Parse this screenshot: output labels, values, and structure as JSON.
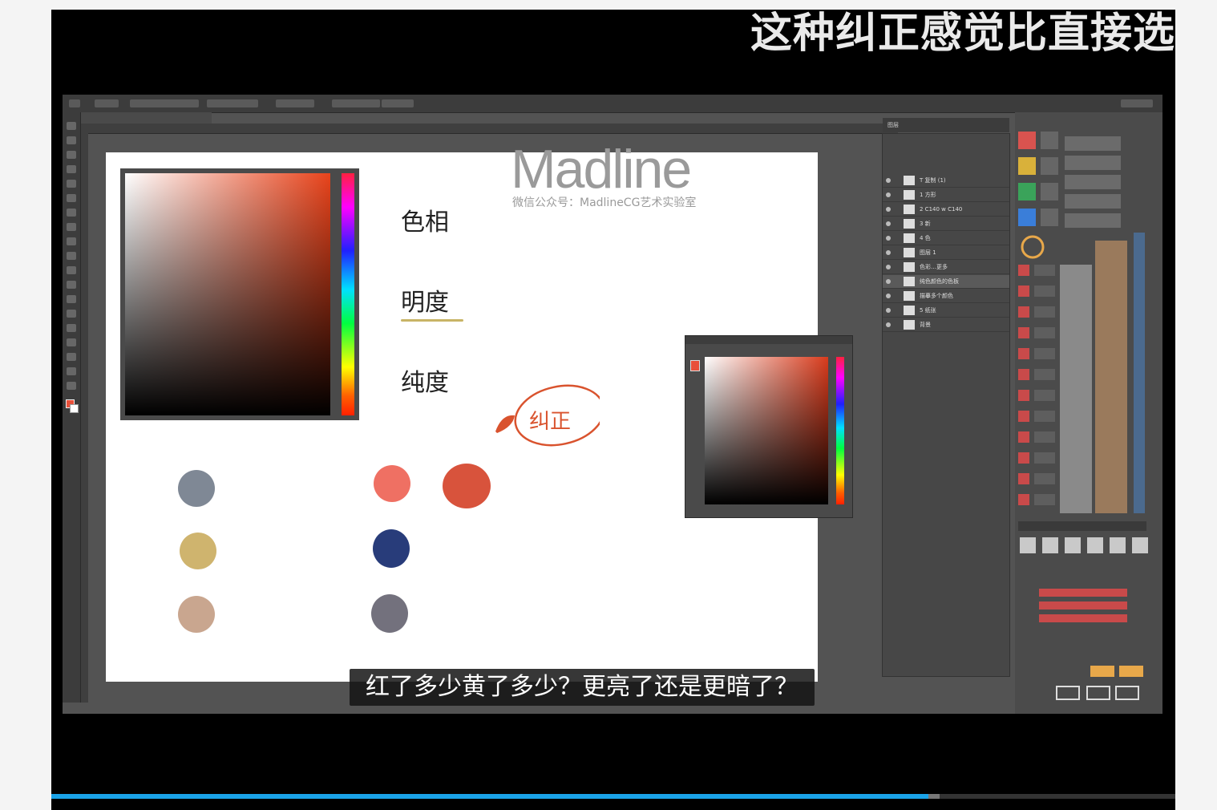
{
  "video": {
    "headline": "这种纠正感觉比直接选",
    "subtitle": "红了多少黄了多少？更亮了还是更暗了？",
    "progress": 0.78,
    "buffered": 0.79
  },
  "canvas": {
    "labels": [
      "色相",
      "明度",
      "纯度"
    ],
    "handwriting": "纠正",
    "logo": "Madline",
    "logo_sub": "微信公众号：MadlineCG艺术实验室"
  },
  "swatches": [
    {
      "color": "#7f8895"
    },
    {
      "color": "#cfb46e"
    },
    {
      "color": "#c9a68f"
    },
    {
      "color": "#ef7063"
    },
    {
      "color": "#d8533c"
    },
    {
      "color": "#283c7a"
    },
    {
      "color": "#73717d"
    }
  ],
  "layers": {
    "title": "图层",
    "items": [
      {
        "name": "T  复制 (1)"
      },
      {
        "name": "1 方形"
      },
      {
        "name": "2 C140 w C140"
      },
      {
        "name": "3 新"
      },
      {
        "name": "4 色"
      },
      {
        "name": "图层 1"
      },
      {
        "name": "色彩…更多"
      },
      {
        "name": "纯色颜色的色板"
      },
      {
        "name": "描摹多个颜色"
      },
      {
        "name": "5 纸张"
      },
      {
        "name": "背景"
      }
    ]
  },
  "colors": {
    "accent": "#1aa3e8",
    "brush": "#d9532e"
  }
}
